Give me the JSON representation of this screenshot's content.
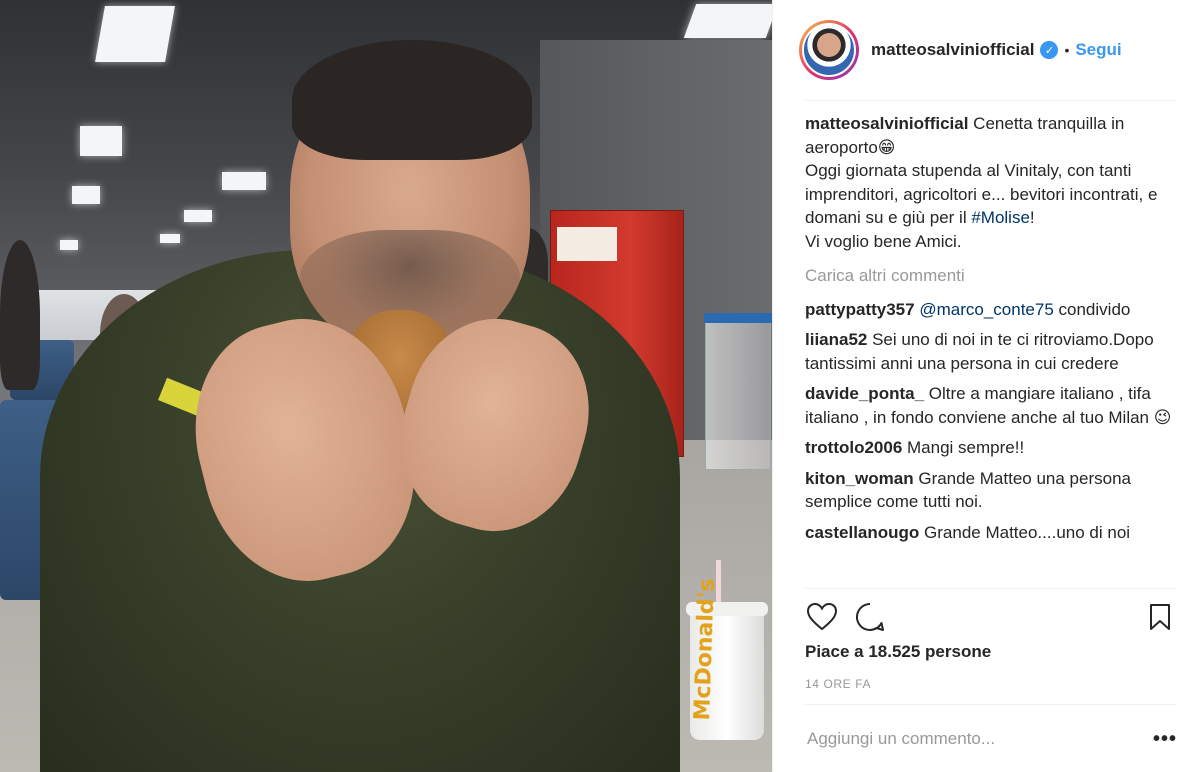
{
  "post": {
    "header": {
      "username": "matteosalviniofficial",
      "verified_icon": "check-icon",
      "separator": "•",
      "follow_label": "Segui"
    },
    "photo": {
      "cup_logo": "McDonald's"
    },
    "caption": {
      "username": "matteosalviniofficial",
      "text_line1": "Cenetta tranquilla in aeroporto😁",
      "text_line2": "Oggi giornata stupenda al Vinitaly, con tanti imprenditori, agricoltori e... bevitori incontrati, e domani su e giù per il ",
      "hashtag": "#Molise",
      "text_line2_end": "!",
      "text_line3": "Vi voglio bene Amici."
    },
    "load_more_label": "Carica altri commenti",
    "comments": [
      {
        "username": "pattypatty357",
        "mention": "@marco_conte75",
        "text": " condivido"
      },
      {
        "username": "liiana52",
        "text": " Sei uno di noi in te ci ritroviamo.Dopo tantissimi anni una persona in cui credere"
      },
      {
        "username": "davide_ponta_",
        "text": " Oltre a mangiare italiano , tifa italiano , in fondo conviene anche al tuo Milan 😉"
      },
      {
        "username": "trottolo2006",
        "text": " Mangi sempre!!"
      },
      {
        "username": "kiton_woman",
        "text": " Grande Matteo una persona semplice come tutti noi."
      },
      {
        "username": "castellanougo",
        "text": " Grande Matteo....uno di noi"
      }
    ],
    "likes_text": "Piace a 18.525 persone",
    "time_text": "14 ORE FA",
    "add_comment_placeholder": "Aggiungi un commento...",
    "more_label": "•••",
    "icons": {
      "like": "heart-icon",
      "comment": "comment-icon",
      "save": "bookmark-icon"
    },
    "colors": {
      "accent": "#3897f0",
      "text": "#262626",
      "muted": "#999999",
      "hashtag": "#003569"
    }
  }
}
